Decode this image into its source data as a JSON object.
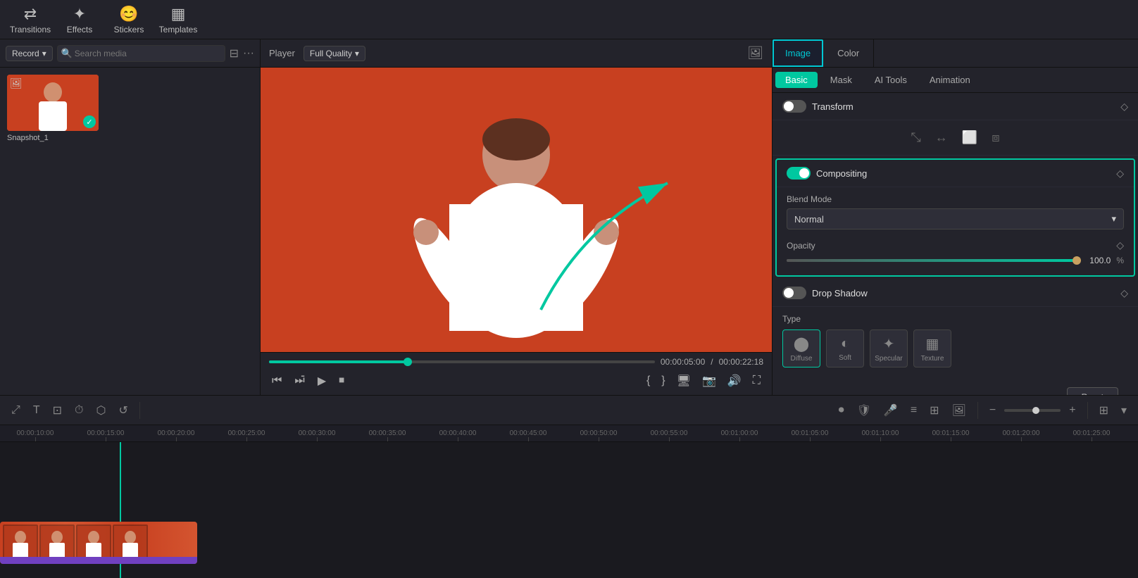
{
  "toolbar": {
    "transitions_label": "Transitions",
    "effects_label": "Effects",
    "stickers_label": "Stickers",
    "templates_label": "Templates"
  },
  "left_panel": {
    "record_label": "Record",
    "search_placeholder": "Search media"
  },
  "player": {
    "label": "Player",
    "quality": "Full Quality",
    "current_time": "00:00:05:00",
    "total_time": "00:00:22:18"
  },
  "right_panel": {
    "tabs_top": [
      "Image",
      "Color"
    ],
    "tabs_second": [
      "Basic",
      "Mask",
      "AI Tools",
      "Animation"
    ],
    "active_top": "Image",
    "active_second": "Basic",
    "transform_label": "Transform",
    "compositing_label": "Compositing",
    "blend_mode_label": "Blend Mode",
    "blend_mode_value": "Normal",
    "opacity_label": "Opacity",
    "opacity_value": "100.0",
    "opacity_unit": "%",
    "drop_shadow_label": "Drop Shadow",
    "type_label": "Type",
    "ds_options": [
      "Diffuse",
      "Soft",
      "Specular",
      "Texture"
    ],
    "reset_label": "Reset"
  },
  "timeline": {
    "ruler_marks": [
      "00:00:10:00",
      "00:00:15:00",
      "00:00:20:00",
      "00:00:25:00",
      "00:00:30:00",
      "00:00:35:00",
      "00:00:40:00",
      "00:00:45:00",
      "00:00:50:00",
      "00:00:55:00",
      "00:01:00:00",
      "00:01:05:00",
      "00:01:10:00",
      "00:01:15:00",
      "00:01:20:00",
      "00:01:25:00"
    ]
  },
  "media_item": {
    "label": "Snapshot_1"
  }
}
